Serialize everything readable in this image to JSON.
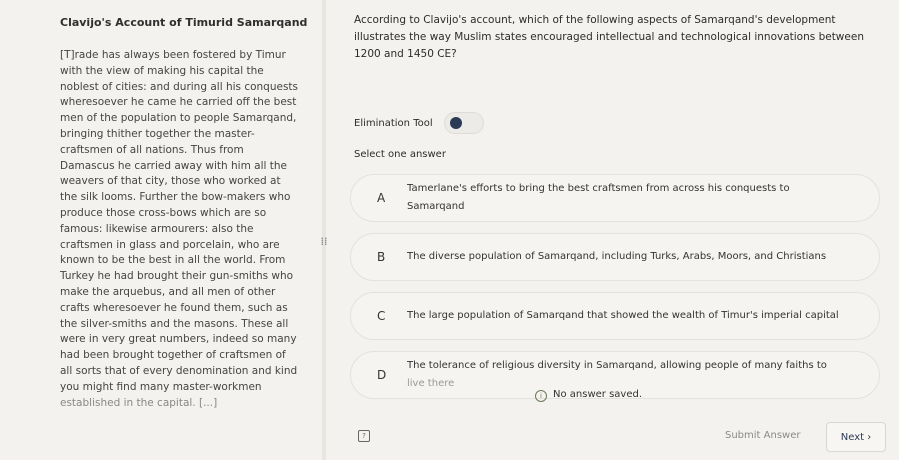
{
  "passage": {
    "title": "Clavijo's Account of Timurid Samarqand",
    "body": "[T]rade has always been fostered by Timur\nwith the view of making his capital the\nnoblest of cities: and during all his conquests\nwheresoever he came he carried off the best\nmen of the population to people Samarqand,\nbringing thither together the master-\ncraftsmen of all nations. Thus from\nDamascus he carried away with him all the\nweavers of that city, those who worked at\nthe silk looms. Further the bow-makers who\nproduce those cross-bows which are so\nfamous: likewise armourers: also the\ncraftsmen in glass and porcelain, who are\nknown to be the best in all the world. From\nTurkey he had brought their gun-smiths who\nmake the arquebus, and all men of other\ncrafts wheresoever he found them, such as\nthe silver-smiths and the masons. These all\nwere in very great numbers, indeed so many\nhad been brought together of craftsmen of\nall sorts that of every denomination and kind\nyou might find many master-workmen",
    "body_cut": "established in the capital. [...]"
  },
  "question": {
    "text": "According to Clavijo's account, which of the following aspects of Samarqand's development illustrates the way Muslim states encouraged intellectual and technological innovations between 1200 and 1450 CE?"
  },
  "elimination_tool": {
    "label": "Elimination Tool"
  },
  "select_label": "Select one answer",
  "options": [
    {
      "letter": "A",
      "text": "Tamerlane's efforts to bring the best craftsmen from across his conquests to Samarqand"
    },
    {
      "letter": "B",
      "text": "The diverse population of Samarqand, including Turks, Arabs, Moors, and Christians"
    },
    {
      "letter": "C",
      "text": "The large population of Samarqand that showed the wealth of Timur's imperial capital"
    },
    {
      "letter": "D",
      "text": "The tolerance of religious diversity in Samarqand, allowing people of many faiths to",
      "text_cut": "live there"
    }
  ],
  "status": {
    "icon": "info-icon",
    "text": "No answer saved."
  },
  "footer": {
    "flag_icon": "flag-icon",
    "submit_label": "Submit Answer",
    "next_label": "Next ›"
  },
  "colors": {
    "accent": "#2b3a55",
    "background": "#f3f2ee",
    "option_bg": "#f5f4f0"
  }
}
